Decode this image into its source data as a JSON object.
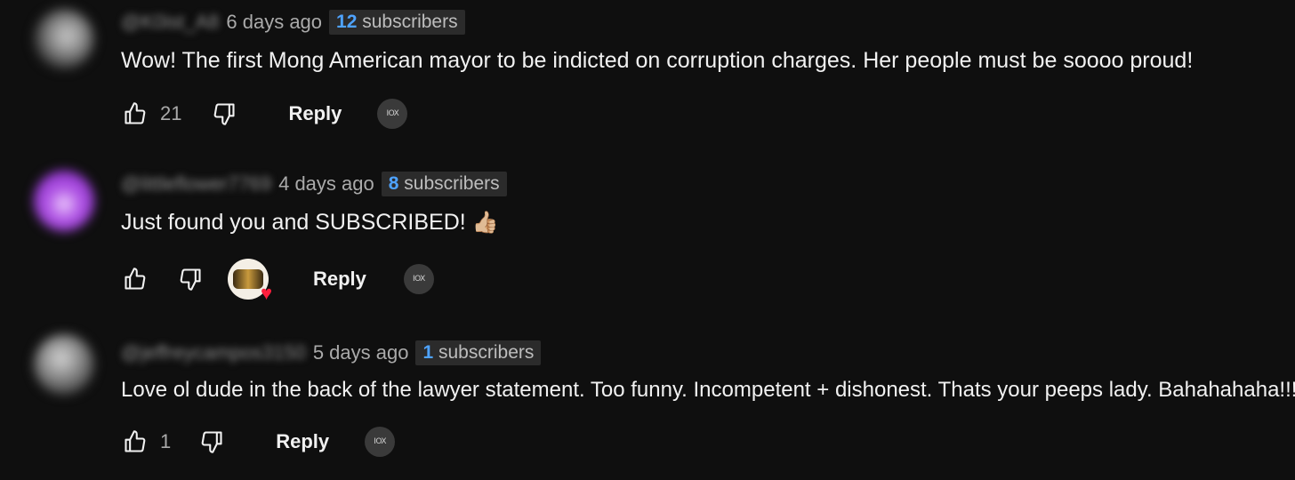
{
  "comments": [
    {
      "handle": "@K0ist_A8",
      "time": "6 days ago",
      "subscribers_count": "12",
      "subscribers_label": "subscribers",
      "text": "Wow! The first Mong American mayor to be indicted on corruption charges. Her people must be soooo proud!",
      "likes": "21",
      "reply_label": "Reply",
      "extension_icon_text": "IOX"
    },
    {
      "handle": "@littleflower7769",
      "time": "4 days ago",
      "subscribers_count": "8",
      "subscribers_label": "subscribers",
      "text": "Just found you and SUBSCRIBED!",
      "emoji": "👍🏼",
      "likes": "",
      "reply_label": "Reply",
      "extension_icon_text": "IOX",
      "creator_hearted": true
    },
    {
      "handle": "@jeffreycampos3150",
      "time": "5 days ago",
      "subscribers_count": "1",
      "subscribers_label": "subscribers",
      "text": "Love ol dude in the back of the lawyer statement. Too funny.  Incompetent + dishonest. Thats your peeps lady. Bahahahaha!!!",
      "likes": "1",
      "reply_label": "Reply",
      "extension_icon_text": "IOX"
    }
  ],
  "icons": {
    "like": "thumbs-up-icon",
    "dislike": "thumbs-down-icon",
    "extension": "iox-extension-icon",
    "heart": "creator-heart-icon"
  },
  "colors": {
    "background": "#0f0f0f",
    "accent_blue": "#4ea3ff",
    "heart_red": "#ff1f3d"
  }
}
